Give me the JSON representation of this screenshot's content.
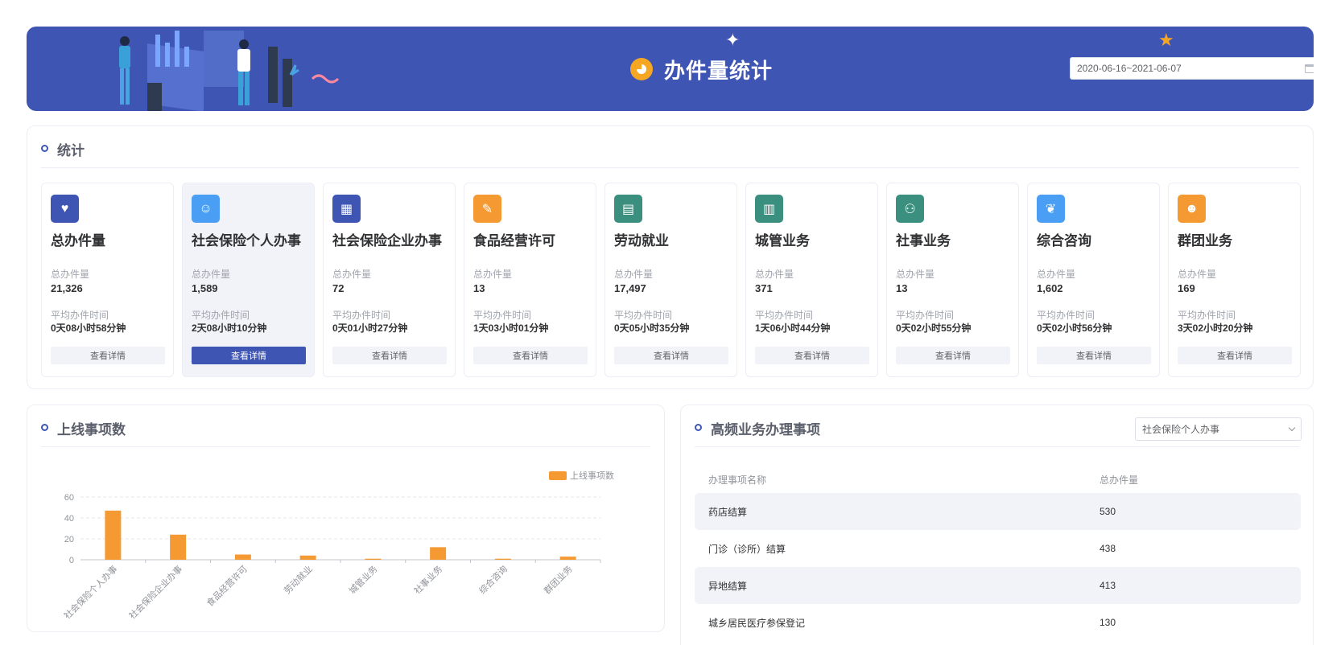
{
  "header": {
    "title": "办件量统计",
    "date_range": "2020-06-16~2021-06-07",
    "colors": {
      "banner": "#3f55b3",
      "accent": "#f5a623"
    }
  },
  "stats": {
    "section_title": "统计",
    "count_label": "总办件量",
    "time_label": "平均办件时间",
    "detail_label": "查看详情",
    "cards": [
      {
        "name": "总办件量",
        "count": "21,326",
        "avg_time": "0天08小时58分钟",
        "icon": "heart-icon",
        "color": "#3f55b3"
      },
      {
        "name": "社会保险个人办事",
        "count": "1,589",
        "avg_time": "2天08小时10分钟",
        "icon": "person-icon",
        "color": "#4a9ff5",
        "active": true
      },
      {
        "name": "社会保险企业办事",
        "count": "72",
        "avg_time": "0天01小时27分钟",
        "icon": "building-icon",
        "color": "#3f55b3"
      },
      {
        "name": "食品经营许可",
        "count": "13",
        "avg_time": "1天03小时01分钟",
        "icon": "license-icon",
        "color": "#f59a33"
      },
      {
        "name": "劳动就业",
        "count": "17,497",
        "avg_time": "0天05小时35分钟",
        "icon": "document-icon",
        "color": "#3a8f7e"
      },
      {
        "name": "城管业务",
        "count": "371",
        "avg_time": "1天06小时44分钟",
        "icon": "city-icon",
        "color": "#3a8f7e"
      },
      {
        "name": "社事业务",
        "count": "13",
        "avg_time": "0天02小时55分钟",
        "icon": "network-icon",
        "color": "#3a8f7e"
      },
      {
        "name": "综合咨询",
        "count": "1,602",
        "avg_time": "0天02小时56分钟",
        "icon": "leaf-icon",
        "color": "#4a9ff5"
      },
      {
        "name": "群团业务",
        "count": "169",
        "avg_time": "3天02小时20分钟",
        "icon": "group-icon",
        "color": "#f59a33"
      }
    ]
  },
  "online": {
    "section_title": "上线事项数"
  },
  "chart_data": {
    "type": "bar",
    "categories": [
      "社会保险个人办事",
      "社会保险企业办事",
      "食品经营许可",
      "劳动就业",
      "城管业务",
      "社事业务",
      "综合咨询",
      "群团业务"
    ],
    "series": [
      {
        "name": "上线事项数",
        "values": [
          47,
          24,
          5,
          4,
          1,
          12,
          1,
          3
        ],
        "color": "#f59a33"
      }
    ],
    "yticks": [
      "0",
      "20",
      "40",
      "60"
    ],
    "ylim": [
      0,
      60
    ],
    "legend": "top-right",
    "grid": true
  },
  "freq": {
    "section_title": "高频业务办理事项",
    "selected": "社会保险个人办事",
    "columns": [
      "办理事项名称",
      "总办件量"
    ],
    "rows": [
      {
        "name": "药店结算",
        "count": "530"
      },
      {
        "name": "门诊（诊所）结算",
        "count": "438"
      },
      {
        "name": "异地结算",
        "count": "413"
      },
      {
        "name": "城乡居民医疗参保登记",
        "count": "130"
      }
    ]
  }
}
